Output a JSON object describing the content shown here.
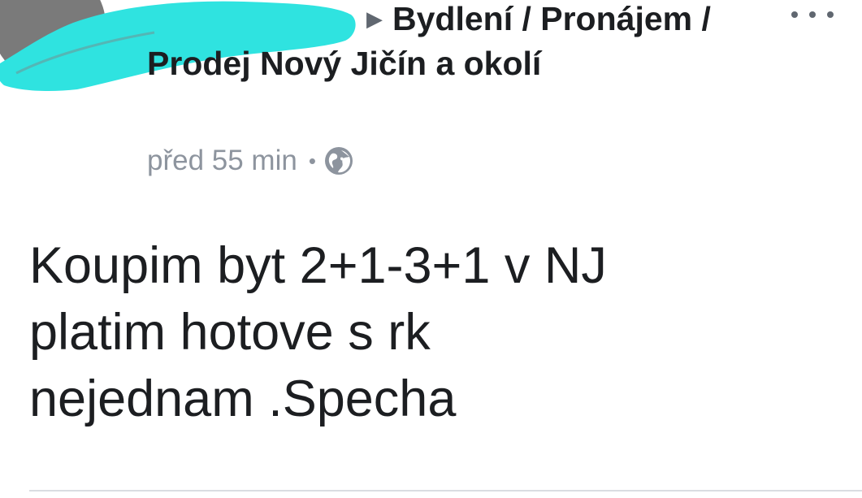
{
  "post": {
    "group_path": "Bydlení / Pronájem / Prodej Nový Jičín a okolí",
    "timestamp": "před 55 min",
    "separator": "•",
    "privacy_icon": "globe-icon",
    "more_icon": "more-dots-icon",
    "body": "Koupim byt 2+1-3+1 v NJ\nplatim hotove s rk\nnejednam .Specha"
  },
  "colors": {
    "redaction": "#2fe3e0",
    "meta": "#8d949e",
    "text": "#1c1e21"
  }
}
